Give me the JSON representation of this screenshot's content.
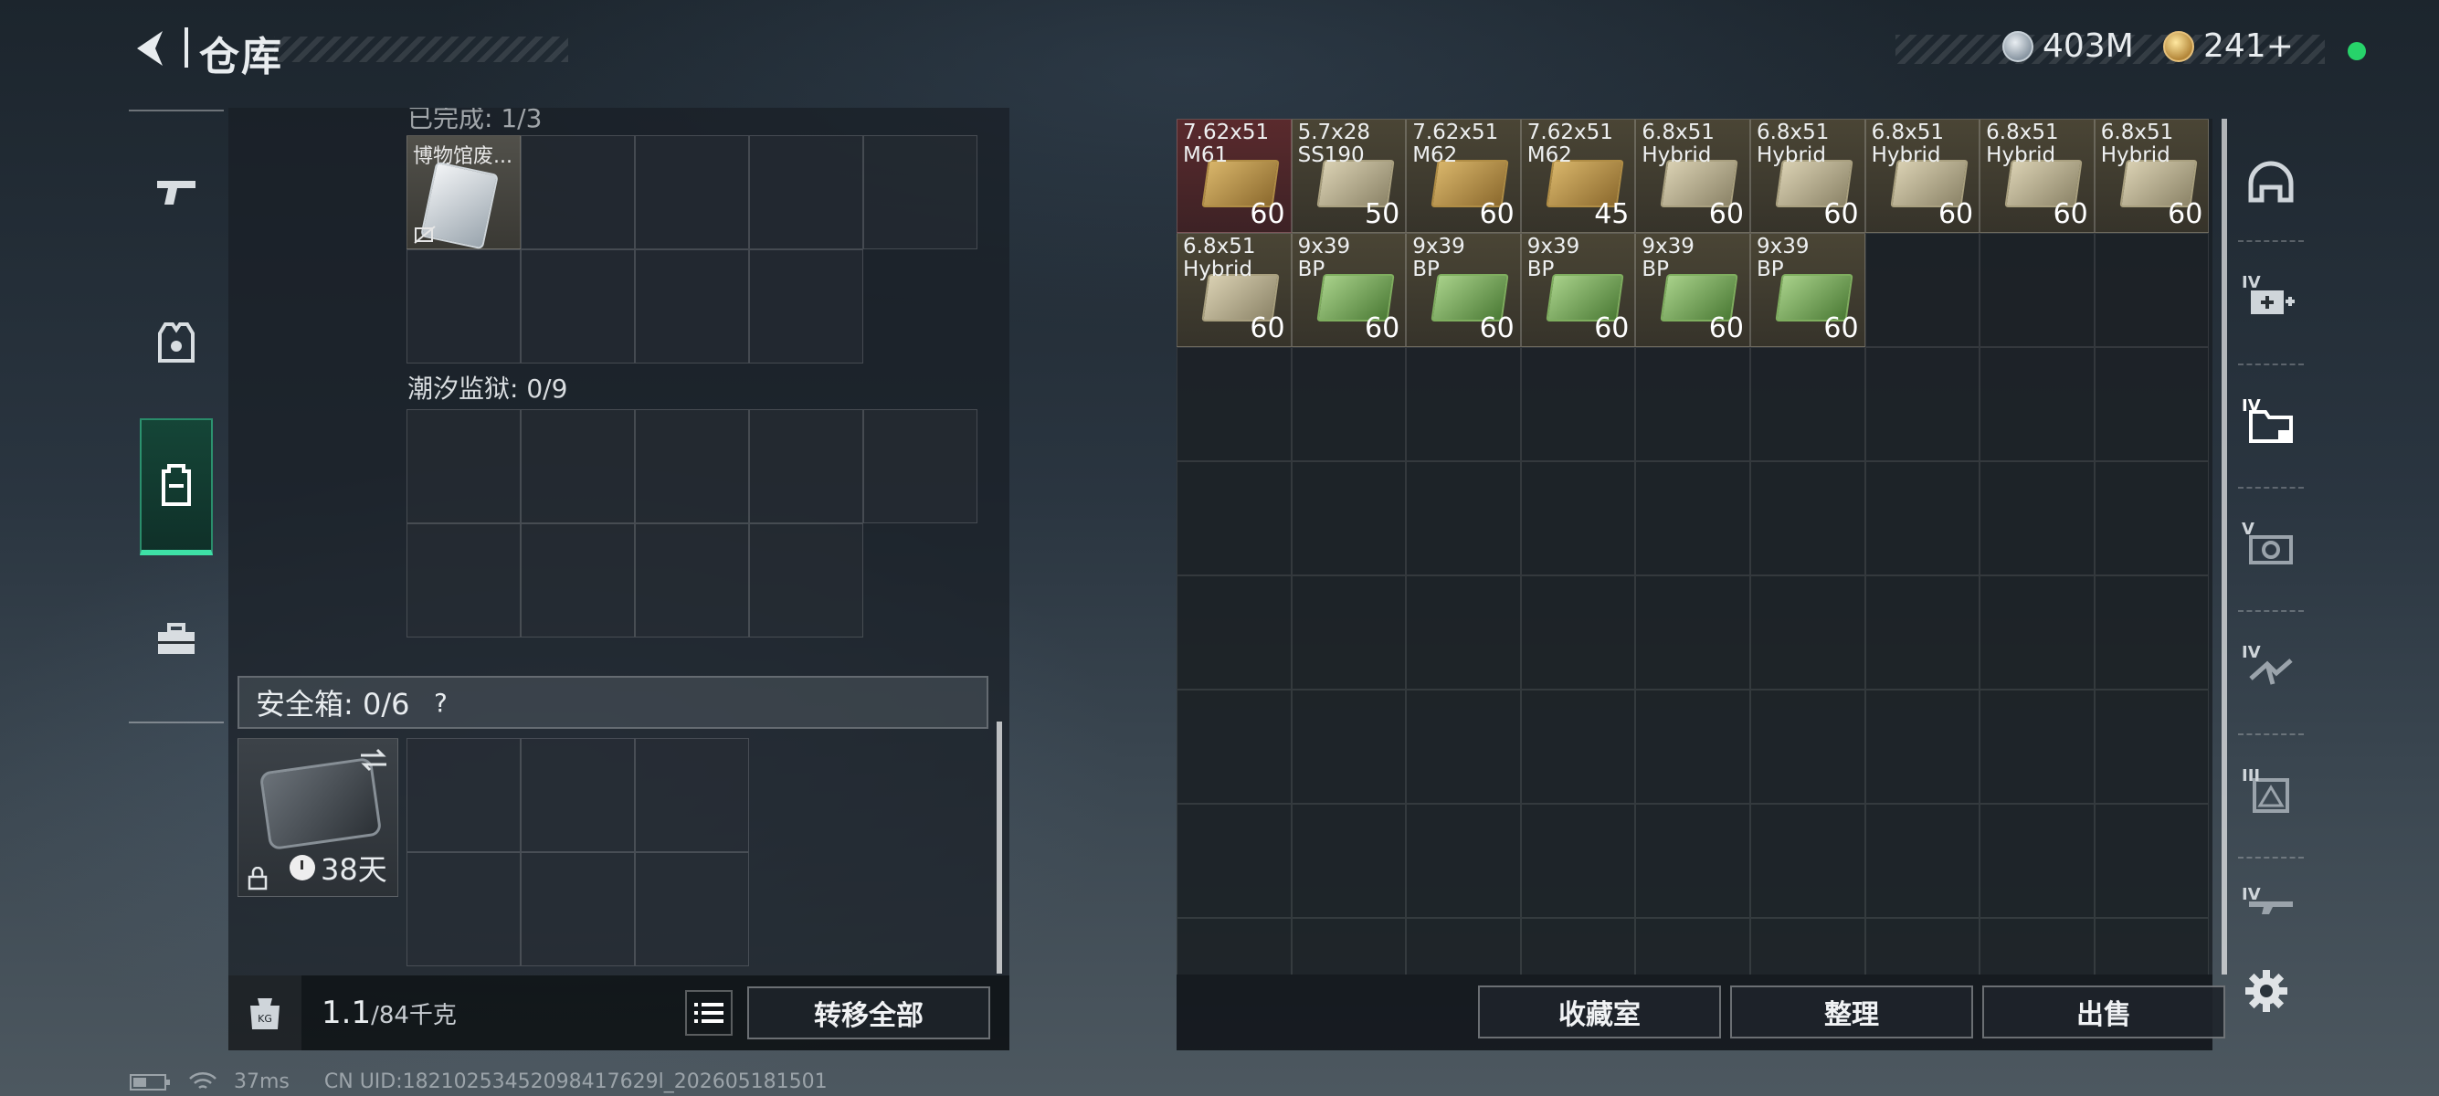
{
  "header": {
    "title": "仓库",
    "currency_silver": "403M",
    "currency_gold": "241+"
  },
  "left": {
    "truncated_label": "已完成: 1/3",
    "doc_item_name": "博物馆废...",
    "tidal_prison_label": "潮汐监狱: 0/9",
    "safe_box_label": "安全箱: 0/6",
    "safe_help": "?",
    "safe_case_days": "38天",
    "weight_current": "1.1",
    "weight_max": "/84千克",
    "transfer_all": "转移全部"
  },
  "stash": {
    "items": [
      {
        "name": "7.62x51\nM61",
        "qty": "60",
        "box": "tan",
        "bg": "red"
      },
      {
        "name": "5.7x28\nSS190",
        "qty": "50",
        "box": "beige",
        "bg": "normal"
      },
      {
        "name": "7.62x51\nM62",
        "qty": "60",
        "box": "tan",
        "bg": "normal"
      },
      {
        "name": "7.62x51\nM62",
        "qty": "45",
        "box": "tan",
        "bg": "normal"
      },
      {
        "name": "6.8x51\nHybrid",
        "qty": "60",
        "box": "beige",
        "bg": "normal"
      },
      {
        "name": "6.8x51\nHybrid",
        "qty": "60",
        "box": "beige",
        "bg": "normal"
      },
      {
        "name": "6.8x51\nHybrid",
        "qty": "60",
        "box": "beige",
        "bg": "normal"
      },
      {
        "name": "6.8x51\nHybrid",
        "qty": "60",
        "box": "beige",
        "bg": "normal"
      },
      {
        "name": "6.8x51\nHybrid",
        "qty": "60",
        "box": "beige",
        "bg": "normal"
      },
      {
        "name": "6.8x51\nHybrid",
        "qty": "60",
        "box": "beige",
        "bg": "normal"
      },
      {
        "name": "9x39\nBP",
        "qty": "60",
        "box": "green",
        "bg": "normal"
      },
      {
        "name": "9x39\nBP",
        "qty": "60",
        "box": "green",
        "bg": "normal"
      },
      {
        "name": "9x39\nBP",
        "qty": "60",
        "box": "green",
        "bg": "normal"
      },
      {
        "name": "9x39\nBP",
        "qty": "60",
        "box": "green",
        "bg": "normal"
      },
      {
        "name": "9x39\nBP",
        "qty": "60",
        "box": "green",
        "bg": "normal"
      }
    ],
    "buttons": {
      "collection": "收藏室",
      "sort": "整理",
      "sell": "出售"
    }
  },
  "tools": [
    {
      "icon": "helmet-icon",
      "level": ""
    },
    {
      "icon": "medkit-icon",
      "level": "IV"
    },
    {
      "icon": "folder-icon",
      "level": "IV"
    },
    {
      "icon": "camera-icon",
      "level": "V"
    },
    {
      "icon": "pliers-icon",
      "level": "IV"
    },
    {
      "icon": "mapbox-icon",
      "level": "III"
    },
    {
      "icon": "weapon-icon",
      "level": "IV"
    }
  ],
  "status": {
    "ping": "37ms",
    "uid": "CN UID:18210253452098417629l_202605181501"
  },
  "colors": {
    "accent_green": "#3ee0a6",
    "online": "#27d36a"
  }
}
